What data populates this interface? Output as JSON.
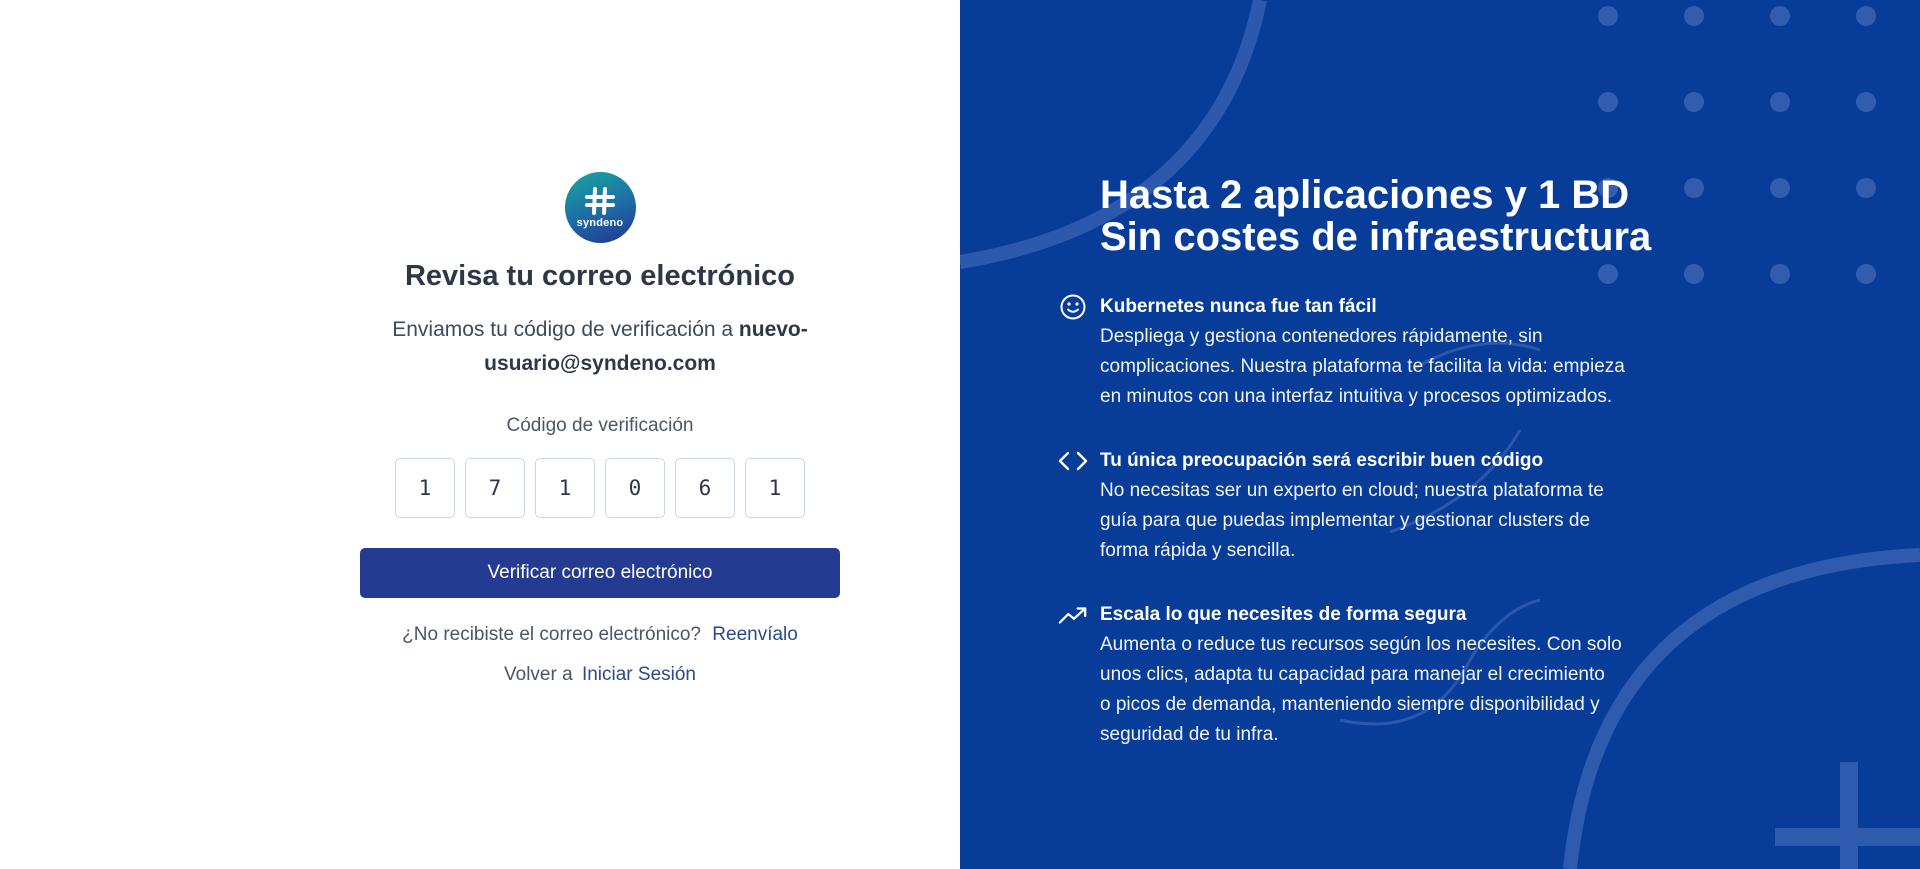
{
  "colors": {
    "brand_gradient_start": "#17a89c",
    "brand_gradient_end": "#22348f",
    "primary_button": "#253b91",
    "right_panel_bg": "#073c99",
    "title_text": "#2d3748",
    "link": "#2b4a8a"
  },
  "logo": {
    "icon": "hash-icon",
    "text": "syndeno"
  },
  "form": {
    "title": "Revisa tu correo electrónico",
    "subtitle_prefix": "Enviamos tu código de verificación a",
    "email": "nuevo-usuario@syndeno.com",
    "code_label": "Código de verificación",
    "code_digits": [
      "1",
      "7",
      "1",
      "0",
      "6",
      "1"
    ],
    "verify_button": "Verificar correo electrónico",
    "resend_question": "¿No recibiste el correo electrónico?",
    "resend_link": "Reenvíalo",
    "back_prefix": "Volver a",
    "back_link": "Iniciar Sesión"
  },
  "promo": {
    "headline_line1": "Hasta 2 aplicaciones y 1 BD",
    "headline_line2": "Sin costes de infraestructura",
    "features": [
      {
        "icon": "smile-icon",
        "title": "Kubernetes nunca fue tan fácil",
        "desc_lines": [
          "Despliega y gestiona contenedores rápidamente, sin",
          "complicaciones. Nuestra plataforma te facilita la vida: empieza",
          "en minutos con una interfaz intuitiva y procesos optimizados."
        ]
      },
      {
        "icon": "code-icon",
        "title": "Tu única preocupación será escribir buen código",
        "desc_lines": [
          "No necesitas ser un experto en cloud; nuestra plataforma te",
          "guía para que puedas implementar y gestionar clusters de",
          "forma rápida y sencilla."
        ]
      },
      {
        "icon": "trending-up-icon",
        "title": "Escala lo que necesites de forma segura",
        "desc_lines": [
          "Aumenta o reduce tus recursos según los necesites. Con solo",
          "unos clics, adapta tu capacidad para manejar el crecimiento",
          "o picos de demanda, manteniendo siempre disponibilidad y",
          "seguridad de tu infra."
        ]
      }
    ]
  }
}
